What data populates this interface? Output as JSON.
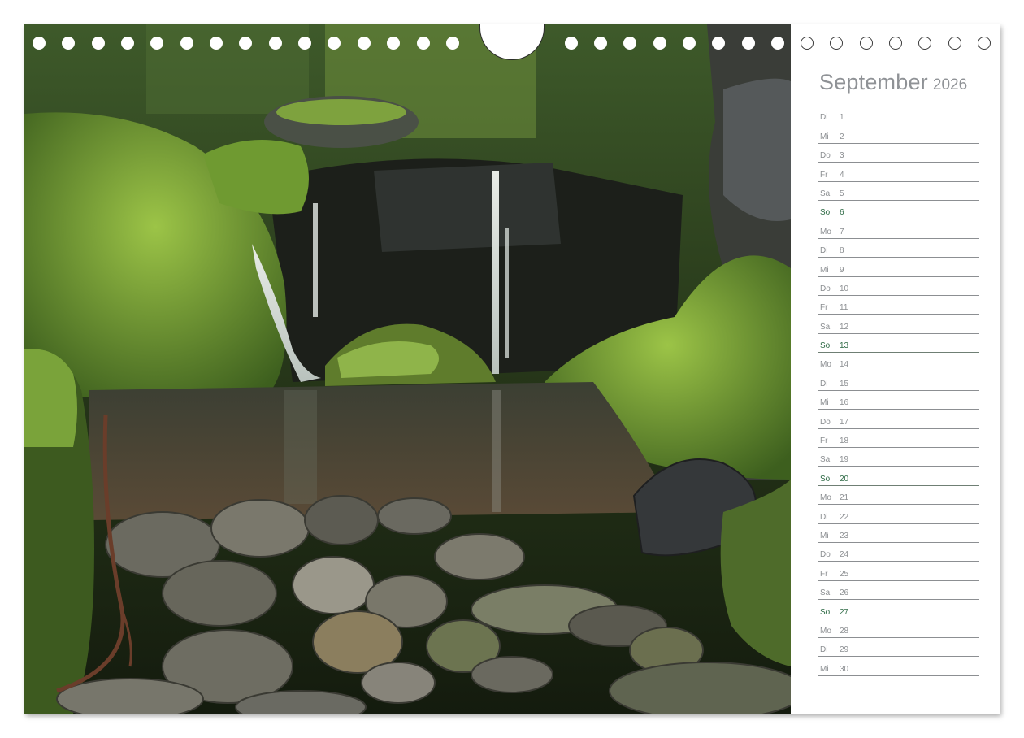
{
  "header": {
    "month": "September",
    "year": "2026"
  },
  "days": [
    {
      "wd": "Di",
      "d": "1",
      "sunday": false
    },
    {
      "wd": "Mi",
      "d": "2",
      "sunday": false
    },
    {
      "wd": "Do",
      "d": "3",
      "sunday": false
    },
    {
      "wd": "Fr",
      "d": "4",
      "sunday": false
    },
    {
      "wd": "Sa",
      "d": "5",
      "sunday": false
    },
    {
      "wd": "So",
      "d": "6",
      "sunday": true
    },
    {
      "wd": "Mo",
      "d": "7",
      "sunday": false
    },
    {
      "wd": "Di",
      "d": "8",
      "sunday": false
    },
    {
      "wd": "Mi",
      "d": "9",
      "sunday": false
    },
    {
      "wd": "Do",
      "d": "10",
      "sunday": false
    },
    {
      "wd": "Fr",
      "d": "11",
      "sunday": false
    },
    {
      "wd": "Sa",
      "d": "12",
      "sunday": false
    },
    {
      "wd": "So",
      "d": "13",
      "sunday": true
    },
    {
      "wd": "Mo",
      "d": "14",
      "sunday": false
    },
    {
      "wd": "Di",
      "d": "15",
      "sunday": false
    },
    {
      "wd": "Mi",
      "d": "16",
      "sunday": false
    },
    {
      "wd": "Do",
      "d": "17",
      "sunday": false
    },
    {
      "wd": "Fr",
      "d": "18",
      "sunday": false
    },
    {
      "wd": "Sa",
      "d": "19",
      "sunday": false
    },
    {
      "wd": "So",
      "d": "20",
      "sunday": true
    },
    {
      "wd": "Mo",
      "d": "21",
      "sunday": false
    },
    {
      "wd": "Di",
      "d": "22",
      "sunday": false
    },
    {
      "wd": "Mi",
      "d": "23",
      "sunday": false
    },
    {
      "wd": "Do",
      "d": "24",
      "sunday": false
    },
    {
      "wd": "Fr",
      "d": "25",
      "sunday": false
    },
    {
      "wd": "Sa",
      "d": "26",
      "sunday": false
    },
    {
      "wd": "So",
      "d": "27",
      "sunday": true
    },
    {
      "wd": "Mo",
      "d": "28",
      "sunday": false
    },
    {
      "wd": "Di",
      "d": "29",
      "sunday": false
    },
    {
      "wd": "Mi",
      "d": "30",
      "sunday": false
    }
  ],
  "colors": {
    "text": "#8c8f92",
    "sunday": "#2f6b46",
    "moss": "#7fa83a",
    "water": "#3a3a30"
  },
  "photo": {
    "subject": "waterfall-in-mossy-forest-gorge"
  }
}
